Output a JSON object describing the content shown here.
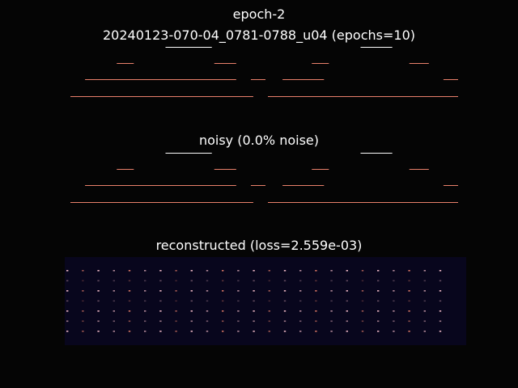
{
  "figure": {
    "title_line1": "epoch-2",
    "title_line2": "20240123-070-04_0781-0788_u04 (epochs=10)"
  },
  "panels": {
    "original_title": "",
    "noisy_title": "noisy (0.0% noise)",
    "reconstructed_title": "reconstructed (loss=2.559e-03)"
  },
  "colors": {
    "background": "#050505",
    "recon_background": "#08061d",
    "note_white": "#ffffff",
    "note_salmon": "#e9806b",
    "note_pink": "#ffc4d0"
  },
  "chart_data": [
    {
      "type": "piano-roll",
      "name_key": "original",
      "time_range": [
        0,
        8
      ],
      "pitch_range": [
        0,
        12
      ],
      "notes": [
        {
          "start": 0.0,
          "end": 3.75,
          "pitch": 1,
          "color": "salmon"
        },
        {
          "start": 0.3,
          "end": 3.4,
          "pitch": 2,
          "color": "salmon"
        },
        {
          "start": 0.95,
          "end": 1.3,
          "pitch": 3,
          "color": "salmon"
        },
        {
          "start": 1.95,
          "end": 2.9,
          "pitch": 4,
          "color": "white"
        },
        {
          "start": 2.95,
          "end": 3.4,
          "pitch": 3,
          "color": "salmon"
        },
        {
          "start": 3.7,
          "end": 4.0,
          "pitch": 2,
          "color": "salmon"
        },
        {
          "start": 4.05,
          "end": 7.95,
          "pitch": 1,
          "color": "salmon"
        },
        {
          "start": 4.35,
          "end": 5.2,
          "pitch": 2,
          "color": "salmon"
        },
        {
          "start": 4.95,
          "end": 5.3,
          "pitch": 3,
          "color": "salmon"
        },
        {
          "start": 5.95,
          "end": 6.6,
          "pitch": 4,
          "color": "white"
        },
        {
          "start": 6.95,
          "end": 7.35,
          "pitch": 3,
          "color": "salmon"
        },
        {
          "start": 7.65,
          "end": 7.95,
          "pitch": 2,
          "color": "salmon"
        }
      ]
    },
    {
      "type": "piano-roll",
      "name_key": "noisy",
      "time_range": [
        0,
        8
      ],
      "pitch_range": [
        0,
        12
      ],
      "notes": [
        {
          "start": 0.0,
          "end": 3.75,
          "pitch": 1,
          "color": "salmon"
        },
        {
          "start": 0.3,
          "end": 3.4,
          "pitch": 2,
          "color": "salmon"
        },
        {
          "start": 0.95,
          "end": 1.3,
          "pitch": 3,
          "color": "salmon"
        },
        {
          "start": 1.95,
          "end": 2.9,
          "pitch": 4,
          "color": "white"
        },
        {
          "start": 2.95,
          "end": 3.4,
          "pitch": 3,
          "color": "salmon"
        },
        {
          "start": 3.7,
          "end": 4.0,
          "pitch": 2,
          "color": "salmon"
        },
        {
          "start": 4.05,
          "end": 7.95,
          "pitch": 1,
          "color": "salmon"
        },
        {
          "start": 4.35,
          "end": 5.2,
          "pitch": 2,
          "color": "salmon"
        },
        {
          "start": 4.95,
          "end": 5.3,
          "pitch": 3,
          "color": "salmon"
        },
        {
          "start": 5.95,
          "end": 6.6,
          "pitch": 4,
          "color": "white"
        },
        {
          "start": 6.95,
          "end": 7.35,
          "pitch": 3,
          "color": "salmon"
        },
        {
          "start": 7.65,
          "end": 7.95,
          "pitch": 2,
          "color": "salmon"
        }
      ]
    },
    {
      "type": "heatmap",
      "name_key": "reconstructed",
      "columns": 25,
      "rows": 7,
      "row_intensity": [
        0.9,
        0.35,
        0.9,
        0.35,
        0.9,
        0.6,
        0.9
      ],
      "background": "#08061d"
    }
  ]
}
